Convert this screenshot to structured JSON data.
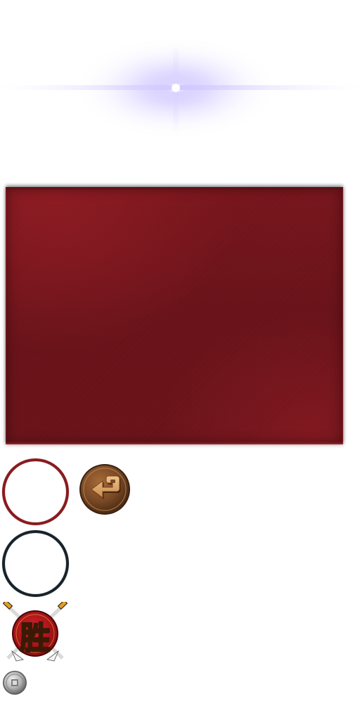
{
  "atlas": {
    "victory_badge": {
      "glyph": "胜",
      "fill_color": "#f6b21c",
      "badge_color": "#b3121a"
    },
    "colors": {
      "panel_red": "#6b1319",
      "ring_red": "#8a1a1e",
      "ring_dark": "#17232b",
      "button_bronze": "#7a4a25",
      "flare_glow": "#c8c0ff"
    },
    "icons": {
      "flare": "light-flare-icon",
      "back": "return-arrow-icon",
      "victory": "victory-badge-icon",
      "coin": "coin-icon"
    }
  }
}
